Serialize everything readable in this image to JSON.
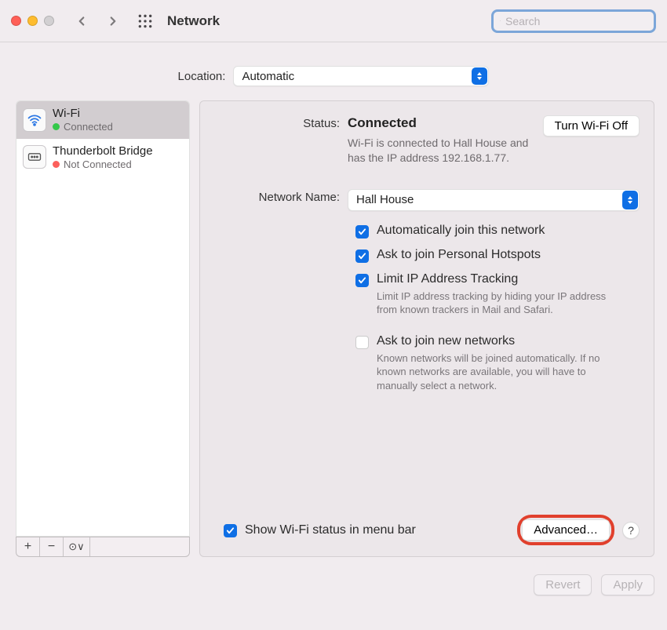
{
  "window": {
    "title": "Network",
    "search_placeholder": "Search"
  },
  "location": {
    "label": "Location:",
    "value": "Automatic"
  },
  "sidebar": {
    "interfaces": [
      {
        "name": "Wi-Fi",
        "status": "Connected",
        "status_color": "green",
        "selected": true,
        "icon": "wifi"
      },
      {
        "name": "Thunderbolt Bridge",
        "status": "Not Connected",
        "status_color": "red",
        "selected": false,
        "icon": "thunderbolt"
      }
    ],
    "footer": {
      "add": "+",
      "remove": "−",
      "more": "⊙∨"
    }
  },
  "detail": {
    "status_label": "Status:",
    "status_value": "Connected",
    "wifi_toggle": "Turn Wi-Fi Off",
    "status_description": "Wi-Fi is connected to Hall House and has the IP address 192.168.1.77.",
    "network_name_label": "Network Name:",
    "network_name_value": "Hall House",
    "checkboxes": {
      "auto_join": {
        "label": "Automatically join this network",
        "checked": true
      },
      "ask_hotspot": {
        "label": "Ask to join Personal Hotspots",
        "checked": true
      },
      "limit_ip": {
        "label": "Limit IP Address Tracking",
        "checked": true,
        "description": "Limit IP address tracking by hiding your IP address from known trackers in Mail and Safari."
      },
      "ask_new": {
        "label": "Ask to join new networks",
        "checked": false,
        "description": "Known networks will be joined automatically. If no known networks are available, you will have to manually select a network."
      }
    },
    "show_status_menubar": {
      "label": "Show Wi-Fi status in menu bar",
      "checked": true
    },
    "advanced_button": "Advanced…",
    "help_button": "?"
  },
  "footer_buttons": {
    "revert": "Revert",
    "apply": "Apply"
  }
}
